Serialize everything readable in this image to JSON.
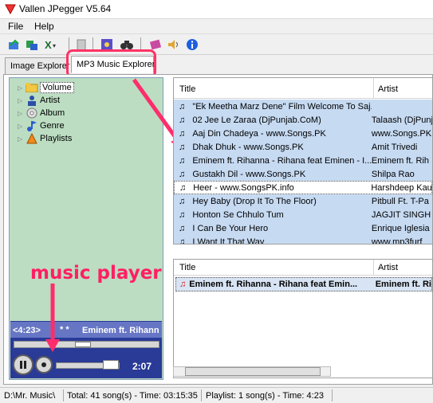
{
  "window": {
    "title": "Vallen JPegger V5.64"
  },
  "menu": [
    {
      "label": "File"
    },
    {
      "label": "Help"
    }
  ],
  "tabs": [
    {
      "label": "Image Explorer"
    },
    {
      "label": "MP3 Music Explorer"
    }
  ],
  "tree": [
    {
      "label": "Volume",
      "icon": "folder-icon"
    },
    {
      "label": "Artist",
      "icon": "artist-icon"
    },
    {
      "label": "Album",
      "icon": "album-icon"
    },
    {
      "label": "Genre",
      "icon": "genre-icon"
    },
    {
      "label": "Playlists",
      "icon": "playlist-icon"
    }
  ],
  "top_table": {
    "columns": [
      "Title",
      "Artist"
    ],
    "rows": [
      {
        "title": "\"Ek Meetha Marz Dene\" Film Welcome To Saj...",
        "artist": ""
      },
      {
        "title": "02 Jee Le Zaraa (DjPunjab.CoM)",
        "artist": "Talaash (DjPunj"
      },
      {
        "title": "Aaj Din Chadeya - www.Songs.PK",
        "artist": "www.Songs.PK"
      },
      {
        "title": "Dhak Dhuk - www.Songs.PK",
        "artist": "Amit Trivedi"
      },
      {
        "title": "Eminem ft. Rihanna - Rihana feat Eminen - I...",
        "artist": "Eminem ft. Rih"
      },
      {
        "title": "Gustakh Dil - www.Songs.PK",
        "artist": "Shilpa Rao"
      },
      {
        "title": "Heer - www.SongsPK.info",
        "artist": "Harshdeep Kau"
      },
      {
        "title": "Hey Baby (Drop It To The Floor)",
        "artist": "Pitbull Ft. T-Pa"
      },
      {
        "title": "Honton Se Chhulo Tum",
        "artist": "JAGJIT SINGH"
      },
      {
        "title": "I Can Be Your Hero",
        "artist": "Enrique Iglesia"
      },
      {
        "title": "I Want It That Way",
        "artist": "www.mp3furf"
      }
    ]
  },
  "bottom_table": {
    "columns": [
      "Title",
      "Artist"
    ],
    "rows": [
      {
        "title": "Eminem ft. Rihanna - Rihana feat Emin...",
        "artist": "Eminem ft. Ri"
      }
    ]
  },
  "player": {
    "time_left": "<4:23>",
    "stars": "* *",
    "title": "Eminem ft. Rihann",
    "elapsed": "2:07"
  },
  "annotation": {
    "text": "music player"
  },
  "status": {
    "path": "D:\\Mr. Music\\",
    "total": "Total: 41 song(s) - Time: 03:15:35",
    "playlist": "Playlist: 1 song(s) - Time: 4:23"
  },
  "colors": {
    "callout": "#ff3366",
    "tree_bg": "#bcddc2",
    "player_bg": "#2a3a97",
    "row_bg": "#c6daf2"
  }
}
